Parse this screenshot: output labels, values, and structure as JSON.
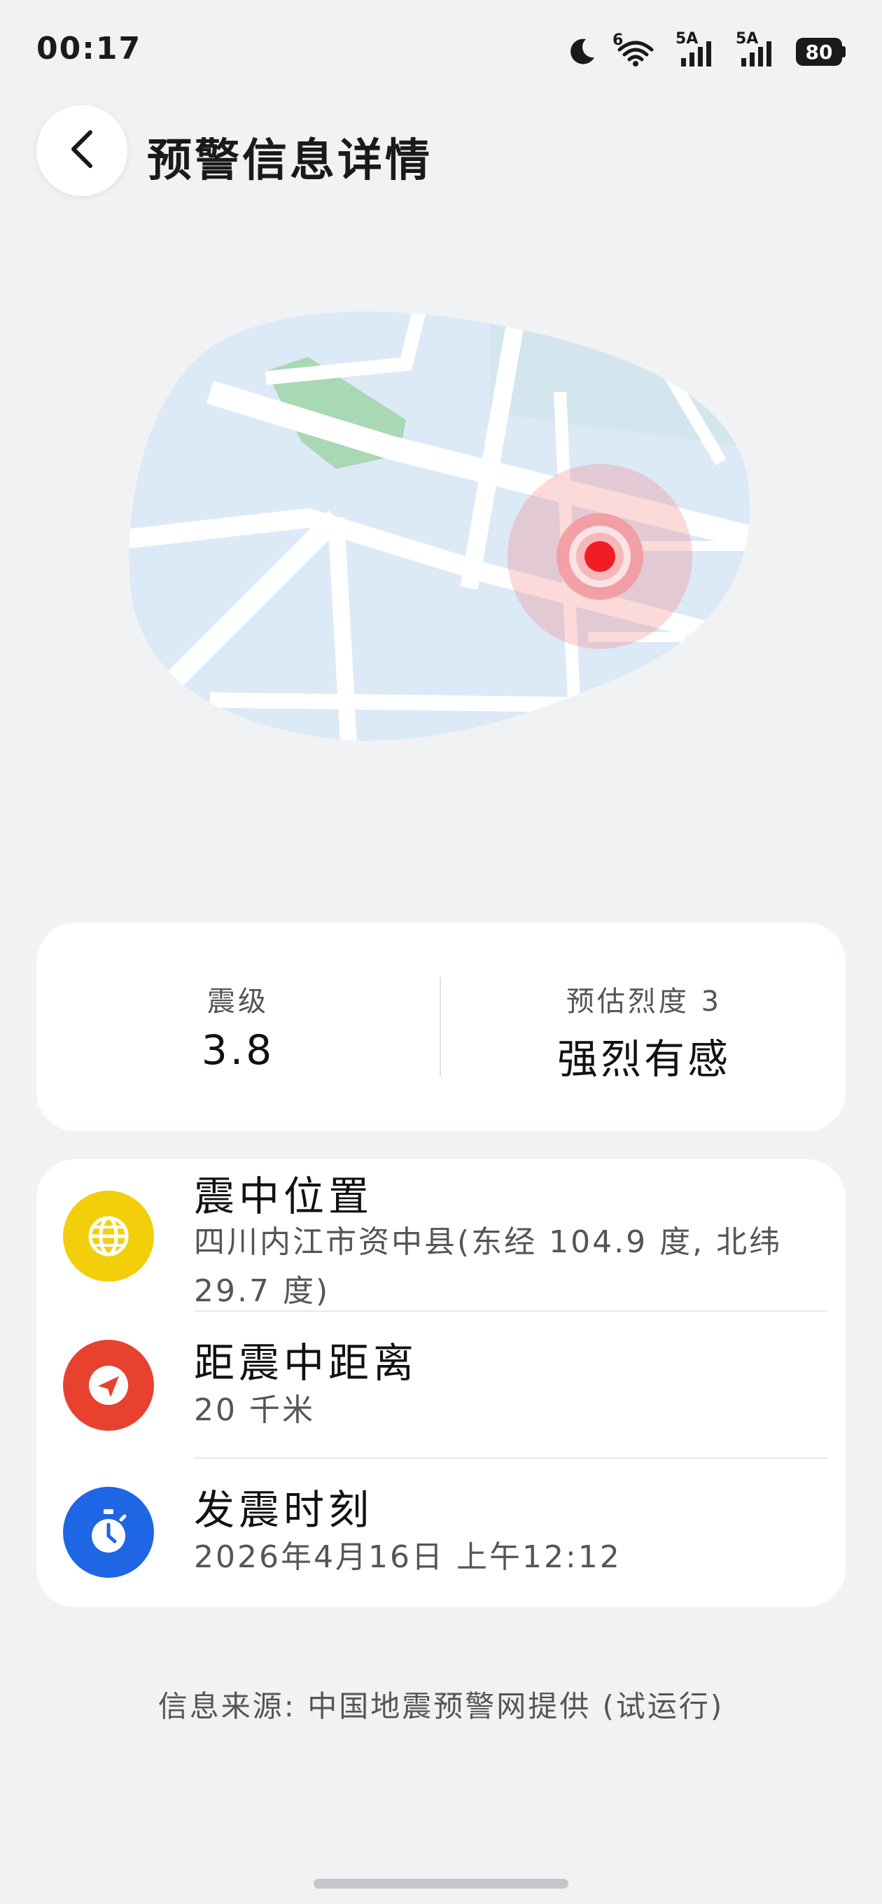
{
  "status_bar": {
    "time": "00:17",
    "wifi_label": "6",
    "signal1_label": "5A",
    "signal2_label": "5A",
    "battery": "80"
  },
  "header": {
    "title": "预警信息详情"
  },
  "map": {
    "park_color": "#a8d8b4",
    "land_color": "#dce9f7",
    "road_color": "#ffffff",
    "epicenter_color": "#f01e24"
  },
  "magnitude_card": {
    "magnitude_label": "震级",
    "magnitude_value": "3.8",
    "intensity_label": "预估烈度 3",
    "intensity_value": "强烈有感"
  },
  "info": {
    "items": [
      {
        "icon": "globe-icon",
        "color": "#f2cf0a",
        "title": "震中位置",
        "value": "四川内江市资中县(东经 104.9 度, 北纬 29.7 度)"
      },
      {
        "icon": "navigation-arrow-icon",
        "color": "#e8412f",
        "title": "距震中距离",
        "value": "20 千米"
      },
      {
        "icon": "stopwatch-icon",
        "color": "#1f66e5",
        "title": "发震时刻",
        "value": "2026年4月16日 上午12:12"
      }
    ]
  },
  "footer": {
    "source": "信息来源: 中国地震预警网提供 (试运行)"
  }
}
